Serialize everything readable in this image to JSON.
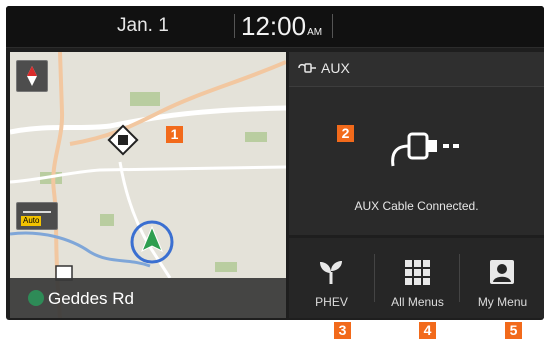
{
  "status_bar": {
    "date": "Jan.  1",
    "time": "12:00",
    "ampm": "AM"
  },
  "map": {
    "road_name": "Geddes Rd",
    "auto_label": "Auto",
    "compass_icon": "north-compass-icon",
    "route_marker_icon": "route-shield-icon"
  },
  "media": {
    "source_label": "AUX",
    "source_icon": "aux-plug-icon",
    "status_text": "AUX Cable Connected."
  },
  "bottom_bar": {
    "buttons": [
      {
        "label": "PHEV",
        "icon": "sprout-icon"
      },
      {
        "label": "All Menus",
        "icon": "grid-icon"
      },
      {
        "label": "My Menu",
        "icon": "user-icon"
      }
    ]
  },
  "callouts": [
    "1",
    "2",
    "3",
    "4",
    "5"
  ],
  "colors": {
    "callout": "#f26a1b",
    "screen_bg": "#1e1e1e",
    "auto_badge": "#f2c200",
    "nav_arrow": "#2e9e4f"
  }
}
